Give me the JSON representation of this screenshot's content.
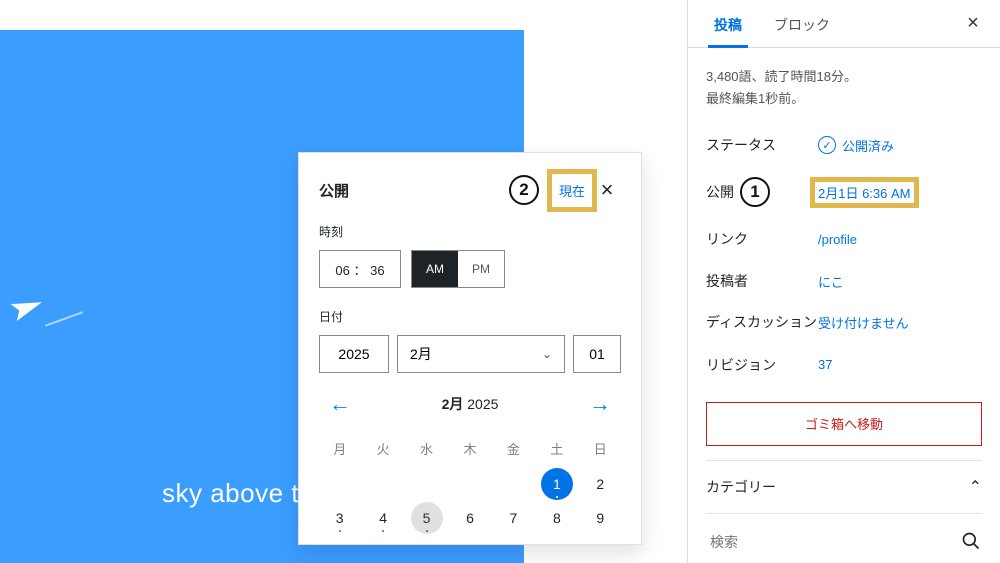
{
  "canvas": {
    "caption": "sky above t"
  },
  "popover": {
    "title": "公開",
    "now_label": "現在",
    "time_label": "時刻",
    "time_value": "06 ： 36",
    "am_label": "AM",
    "pm_label": "PM",
    "date_label": "日付",
    "year": "2025",
    "month": "2月",
    "day": "01",
    "cal_month": "2月",
    "cal_year": "2025",
    "dow": [
      "月",
      "火",
      "水",
      "木",
      "金",
      "土",
      "日"
    ],
    "annot": "2"
  },
  "sidebar": {
    "tabs": {
      "post": "投稿",
      "block": "ブロック"
    },
    "summary_words": "3,480語、読了時間18分。",
    "summary_edited": "最終編集1秒前。",
    "status": {
      "label": "ステータス",
      "value": "公開済み"
    },
    "publish": {
      "label": "公開",
      "value": "2月1日 6:36 AM",
      "annot": "1"
    },
    "link": {
      "label": "リンク",
      "value": "/profile"
    },
    "author": {
      "label": "投稿者",
      "value": "にこ"
    },
    "discussion": {
      "label": "ディスカッション",
      "value": "受け付けません"
    },
    "revisions": {
      "label": "リビジョン",
      "value": "37"
    },
    "trash": "ゴミ箱へ移動",
    "panel_categories": "カテゴリー",
    "search_placeholder": "検索"
  }
}
